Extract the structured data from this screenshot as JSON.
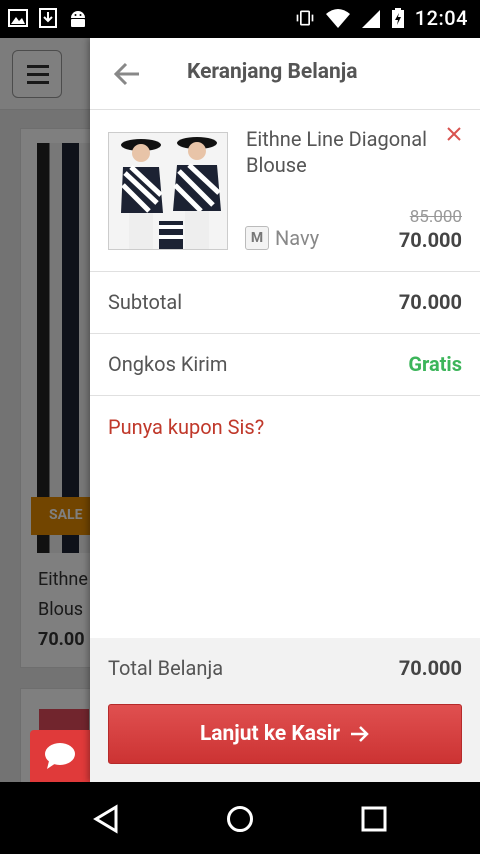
{
  "status_bar": {
    "time": "12:04"
  },
  "background": {
    "sale_badge": "SALE",
    "card_title_line1": "Eithne",
    "card_title_line2": "Blous",
    "card_price": "70.00"
  },
  "drawer": {
    "title": "Keranjang Belanja",
    "item": {
      "name": "Eithne Line Diagonal Blouse",
      "size": "M",
      "color": "Navy",
      "price_old": "85.000",
      "price_new": "70.000"
    },
    "subtotal": {
      "label": "Subtotal",
      "value": "70.000"
    },
    "shipping": {
      "label": "Ongkos Kirim",
      "value": "Gratis"
    },
    "coupon_link": "Punya kupon Sis?",
    "total": {
      "label": "Total Belanja",
      "value": "70.000"
    },
    "checkout_label": "Lanjut ke Kasir"
  },
  "colors": {
    "accent_red": "#cc3333",
    "green": "#3cb55a",
    "coupon_red": "#c0392b"
  },
  "icons": [
    "image-icon",
    "download-icon",
    "android-icon",
    "vibrate-icon",
    "wifi-icon",
    "signal-icon",
    "battery-icon",
    "back-arrow-icon",
    "close-icon",
    "chat-icon",
    "chevron-up-icon",
    "nav-back-icon",
    "nav-home-icon",
    "nav-recents-icon"
  ]
}
